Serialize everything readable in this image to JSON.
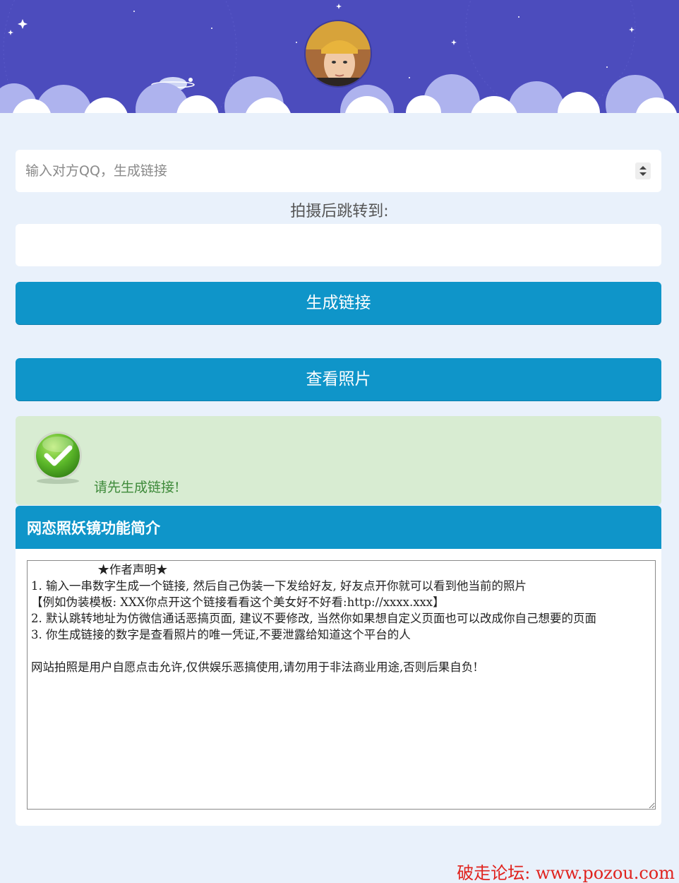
{
  "header": {
    "avatar_label": "avatar"
  },
  "form": {
    "qq_placeholder": "输入对方QQ，生成链接",
    "qq_value": "",
    "redirect_label": "拍摄后跳转到:",
    "redirect_value": "",
    "generate_label": "生成链接",
    "view_label": "查看照片"
  },
  "alert": {
    "text": "请先生成链接!"
  },
  "panel": {
    "title": "网恋照妖镜功能简介",
    "notice": "                  ★作者声明★\n1. 输入一串数字生成一个链接, 然后自己伪装一下发给好友, 好友点开你就可以看到他当前的照片\n【例如伪装模板: XXX你点开这个链接看看这个美女好不好看:http://xxxx.xxx】\n2. 默认跳转地址为仿微信通话恶搞页面, 建议不要修改, 当然你如果想自定义页面也可以改成你自己想要的页面\n3. 你生成链接的数字是查看照片的唯一凭证,不要泄露给知道这个平台的人\n\n网站拍照是用户自愿点击允许,仅供娱乐恶搞使用,请勿用于非法商业用途,否则后果自负!"
  },
  "watermark": {
    "text": "破走论坛: www.pozou.com"
  },
  "colors": {
    "header_bg": "#4c4cbd",
    "accent": "#0f95c9",
    "success_bg": "#d8ecd2",
    "watermark": "#e0231e"
  }
}
